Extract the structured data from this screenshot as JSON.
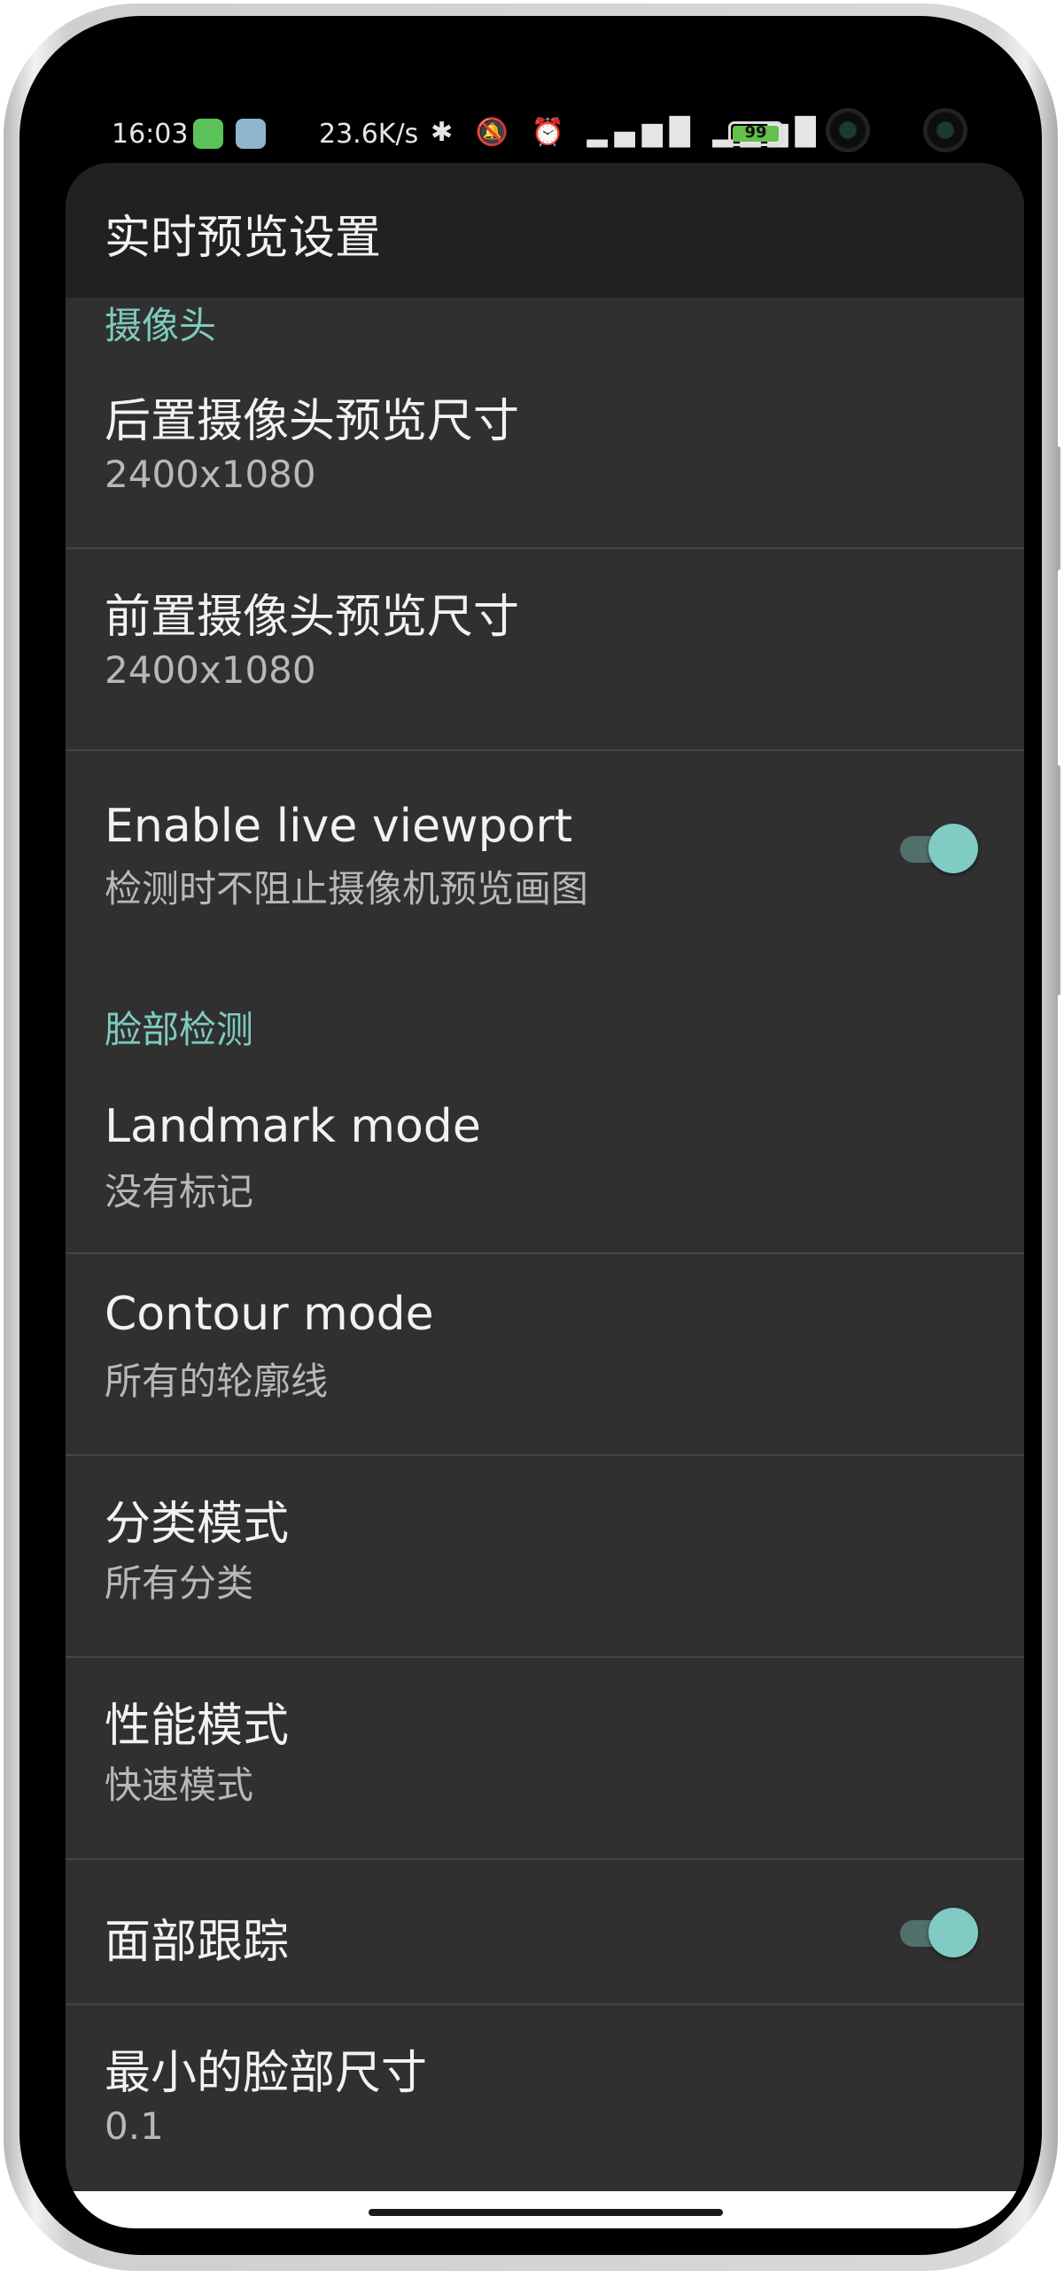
{
  "status_bar": {
    "time": "16:03",
    "net_speed": "23.6K/s",
    "icons_glyphs": "✱ 🔕 ⏰ ▂▄▆█ ▂▄▆█ ◠",
    "battery": "99",
    "bolt": "ϟ",
    "icons": [
      "app-notification-icon",
      "app-notification-icon",
      "bluetooth-icon",
      "mute-icon",
      "alarm-icon",
      "signal-hd-icon",
      "signal-hd-icon",
      "wifi-icon",
      "battery-icon",
      "charging-icon"
    ],
    "battery_level": 0.99,
    "colors": {
      "battery_fill": "#63c04a"
    }
  },
  "app_bar": {
    "title": "实时预览设置"
  },
  "sections": {
    "camera": {
      "header": "摄像头",
      "rear_preview": {
        "title": "后置摄像头预览尺寸",
        "summary": "2400x1080"
      },
      "front_preview": {
        "title": "前置摄像头预览尺寸",
        "summary": "2400x1080"
      },
      "live_viewport": {
        "title": "Enable live viewport",
        "summary": "检测时不阻止摄像机预览画图",
        "checked": true
      }
    },
    "face_detection": {
      "header": "脸部检测",
      "landmark_mode": {
        "title": "Landmark mode",
        "summary": "没有标记"
      },
      "contour_mode": {
        "title": "Contour mode",
        "summary": "所有的轮廓线"
      },
      "classification_mode": {
        "title": "分类模式",
        "summary": "所有分类"
      },
      "performance_mode": {
        "title": "性能模式",
        "summary": "快速模式"
      },
      "face_tracking": {
        "title": "面部跟踪",
        "checked": true
      },
      "min_face_size": {
        "title": "最小的脸部尺寸",
        "summary": "0.1"
      }
    }
  },
  "colors": {
    "accent": "#80cbc4",
    "category_text": "#7ecbbf",
    "background": "#303030",
    "app_bar": "#212121"
  }
}
